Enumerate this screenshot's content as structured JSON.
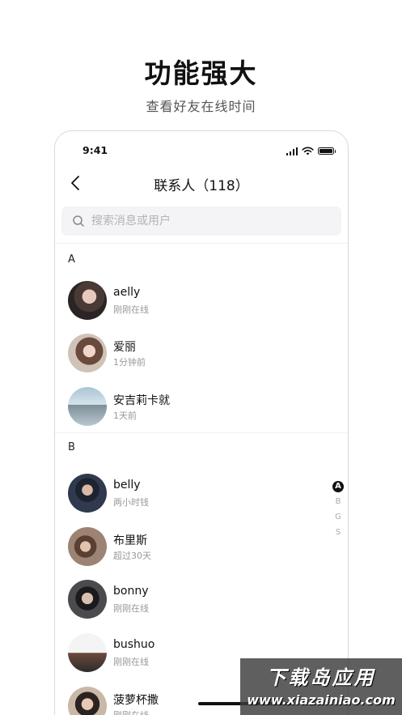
{
  "promo": {
    "title": "功能强大",
    "subtitle": "查看好友在线时间"
  },
  "status_bar": {
    "time": "9:41",
    "icons": [
      "signal-icon",
      "wifi-icon",
      "battery-icon"
    ]
  },
  "nav": {
    "back_icon": "chevron-left-icon",
    "title": "联系人（118）"
  },
  "search": {
    "placeholder": "搜索消息或用户",
    "value": ""
  },
  "sections": [
    {
      "letter": "A",
      "contacts": [
        {
          "name": "aelly",
          "status": "刚刚在线"
        },
        {
          "name": "爱丽",
          "status": "1分钟前"
        },
        {
          "name": "安吉莉卡就",
          "status": "1天前"
        }
      ]
    },
    {
      "letter": "B",
      "contacts": [
        {
          "name": "belly",
          "status": "两小时钱"
        },
        {
          "name": "布里斯",
          "status": "超过30天"
        },
        {
          "name": "bonny",
          "status": "刚刚在线"
        },
        {
          "name": "bushuo",
          "status": "刚刚在线"
        },
        {
          "name": "菠萝杯撒",
          "status": "刚刚在线"
        }
      ]
    }
  ],
  "index": {
    "letters": [
      "A",
      "B",
      "G",
      "S"
    ],
    "active": "A"
  },
  "watermark": {
    "top": "下载岛应用",
    "bottom": "www.xiazainiao.com"
  },
  "colors": {
    "accent": "#111111",
    "search_bg": "#f4f4f6",
    "muted_text": "#999999"
  }
}
